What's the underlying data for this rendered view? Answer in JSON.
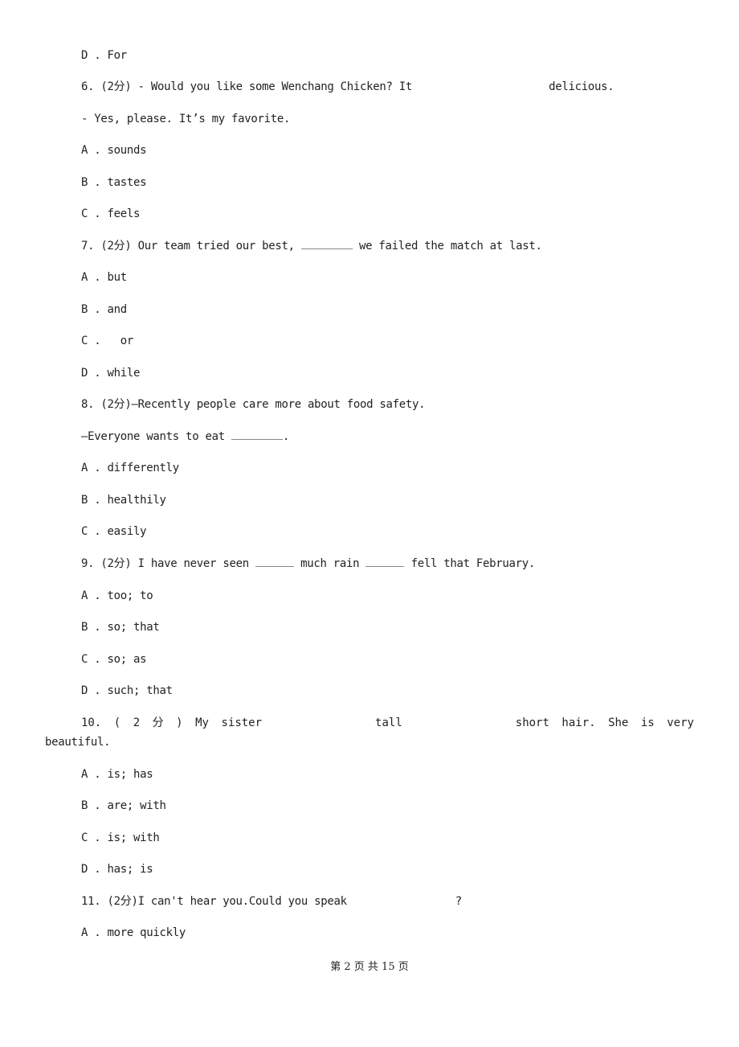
{
  "items": {
    "prev_d": "D . For",
    "q6": {
      "num": "6.",
      "score": "(2分)",
      "text_a": "- Would you like some Wenchang Chicken? It",
      "text_b": "delicious.",
      "line2": "- Yes, please. It’s my favorite.",
      "options": [
        "A . sounds",
        "B . tastes",
        "C . feels"
      ]
    },
    "q7": {
      "num": "7.",
      "score": "(2分)",
      "text_a": "Our team tried our best,",
      "text_b": "we failed the match at last.",
      "options": [
        "A . but",
        "B . and",
        "C .   or",
        "D . while"
      ]
    },
    "q8": {
      "num": "8.",
      "score": "(2分)",
      "text": "—Recently people care more about food safety.",
      "line2_a": "—Everyone wants to eat",
      "line2_b": ".",
      "options": [
        "A . differently",
        "B . healthily",
        "C . easily"
      ]
    },
    "q9": {
      "num": "9.",
      "score": "(2分)",
      "text_a": "I have never seen",
      "text_b": "much rain",
      "text_c": "fell that February.",
      "options": [
        "A . too; to",
        "B . so; that",
        "C . so; as",
        "D . such; that"
      ]
    },
    "q10": {
      "words": [
        "10.",
        "(",
        "2",
        "分",
        ")",
        "My",
        "sister",
        "tall",
        "short",
        "hair.",
        "She",
        "is",
        "very"
      ],
      "line2": "beautiful.",
      "options": [
        "A . is; has",
        "B . are; with",
        "C . is; with",
        "D . has; is"
      ]
    },
    "q11": {
      "num": "11.",
      "score": "(2分)",
      "text_a": "I can't hear you.Could you speak",
      "text_b": "?",
      "options": [
        "A . more quickly"
      ]
    }
  },
  "footer": "第 2 页 共 15 页"
}
